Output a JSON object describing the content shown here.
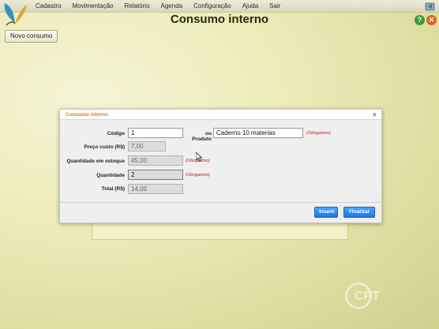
{
  "menu": [
    "Cadastro",
    "Movimentação",
    "Relatório",
    "Agenda",
    "Configuração",
    "Ajuda",
    "Sair"
  ],
  "page": {
    "title": "Consumo interno",
    "help_symbol": "?",
    "close_symbol": "✕",
    "new_button": "Novo consumo"
  },
  "dialog": {
    "title": "Consumo interno",
    "close_symbol": "×",
    "codigo_label": "Código",
    "codigo_value": "1",
    "produto_label": "ou Produto",
    "produto_value": "Caderno 10 materias",
    "preco_label": "Preço custo (R$)",
    "preco_value": "7,00",
    "estoque_label": "Quantidade em estoque",
    "estoque_value": "45,00",
    "quantidade_label": "Quantidade",
    "quantidade_value": "2",
    "total_label": "Total (R$)",
    "total_value": "14,00",
    "required_text": "(Obrigatório)",
    "insert_button": "Inserir",
    "finish_button": "Finalizar"
  },
  "watermark": "CPT",
  "colors": {
    "accent_orange": "#e07a1a",
    "primary_blue": "#1c76e0",
    "required_red": "#c02020",
    "help_green": "#3b9b3b"
  },
  "icons": {
    "logo": "butterfly-logo",
    "top_right": "refresh-icon",
    "help": "help-icon",
    "close": "close-icon",
    "cursor": "mouse-cursor"
  }
}
